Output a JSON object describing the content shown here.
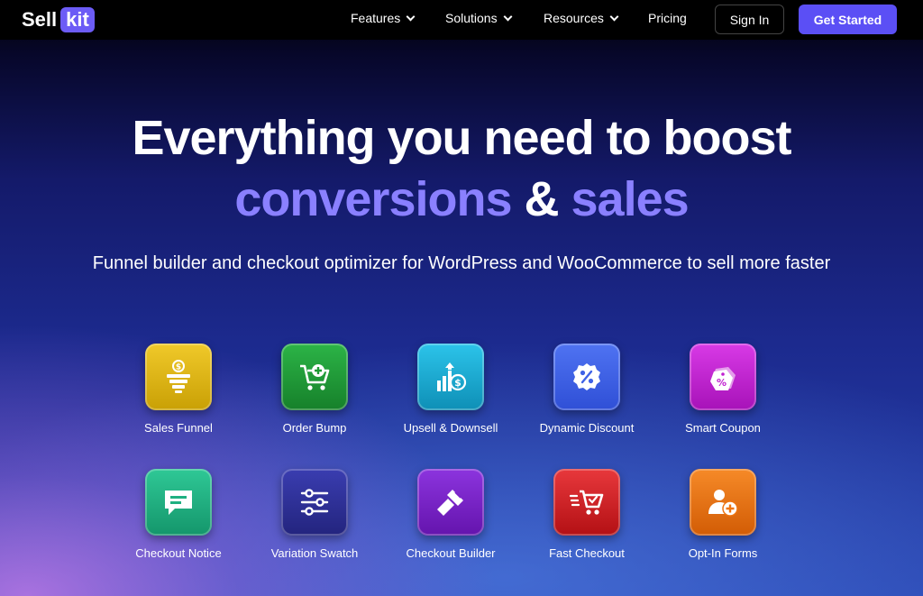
{
  "nav": {
    "logo_sell": "Sell",
    "logo_kit": "kit",
    "items": [
      {
        "label": "Features",
        "has_dropdown": true
      },
      {
        "label": "Solutions",
        "has_dropdown": true
      },
      {
        "label": "Resources",
        "has_dropdown": true
      },
      {
        "label": "Pricing",
        "has_dropdown": false
      }
    ],
    "sign_in": "Sign In",
    "get_started": "Get Started"
  },
  "hero": {
    "line1": "Everything you need to boost",
    "accent1": "conversions",
    "amp": " & ",
    "accent2": "sales",
    "subtitle": "Funnel builder and checkout optimizer for WordPress and WooCommerce to sell more faster"
  },
  "features": [
    {
      "label": "Sales Funnel",
      "icon": "funnel-dollar-icon",
      "color": "#d8b210"
    },
    {
      "label": "Order Bump",
      "icon": "cart-plus-icon",
      "color": "#1f9a35"
    },
    {
      "label": "Upsell & Downsell",
      "icon": "chart-dollar-icon",
      "color": "#17a9d0"
    },
    {
      "label": "Dynamic Discount",
      "icon": "percent-badge-icon",
      "color": "#3f62e6"
    },
    {
      "label": "Smart Coupon",
      "icon": "coupon-tag-icon",
      "color": "#c01fd0"
    },
    {
      "label": "Checkout Notice",
      "icon": "message-icon",
      "color": "#1fb081"
    },
    {
      "label": "Variation Swatch",
      "icon": "sliders-icon",
      "color": "#2d2f9a"
    },
    {
      "label": "Checkout Builder",
      "icon": "paint-brush-icon",
      "color": "#7a22c8"
    },
    {
      "label": "Fast Checkout",
      "icon": "fast-cart-icon",
      "color": "#d41d22"
    },
    {
      "label": "Opt-In Forms",
      "icon": "user-add-icon",
      "color": "#ee7410"
    }
  ]
}
